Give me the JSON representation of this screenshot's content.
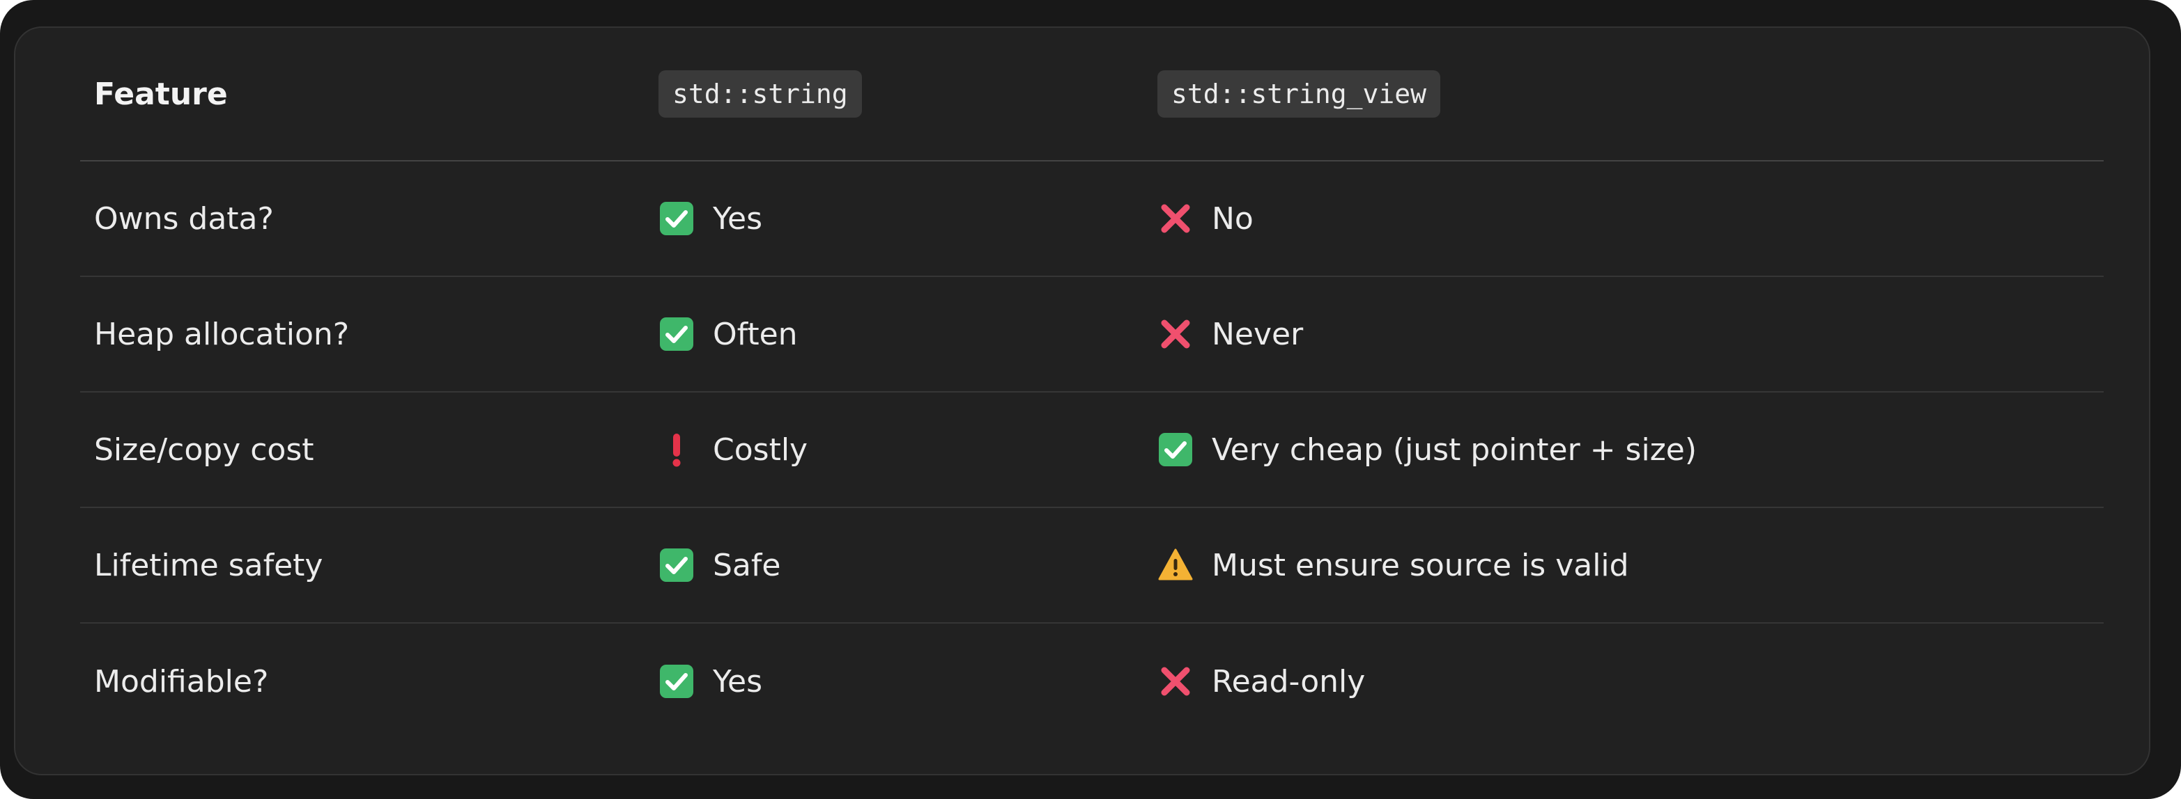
{
  "table": {
    "headers": [
      "Feature",
      "std::string",
      "std::string_view"
    ],
    "rows": [
      {
        "feature": "Owns data?",
        "string": {
          "icon": "check-mark-icon",
          "text": "Yes"
        },
        "view": {
          "icon": "cross-mark-icon",
          "text": "No"
        }
      },
      {
        "feature": "Heap allocation?",
        "string": {
          "icon": "check-mark-icon",
          "text": "Often"
        },
        "view": {
          "icon": "cross-mark-icon",
          "text": "Never"
        }
      },
      {
        "feature": "Size/copy cost",
        "string": {
          "icon": "exclamation-icon",
          "text": "Costly"
        },
        "view": {
          "icon": "check-mark-icon",
          "text": "Very cheap (just pointer + size)"
        }
      },
      {
        "feature": "Lifetime safety",
        "string": {
          "icon": "check-mark-icon",
          "text": "Safe"
        },
        "view": {
          "icon": "warning-icon",
          "text": "Must ensure source is valid"
        }
      },
      {
        "feature": "Modifiable?",
        "string": {
          "icon": "check-mark-icon",
          "text": "Yes"
        },
        "view": {
          "icon": "cross-mark-icon",
          "text": "Read-only"
        }
      }
    ]
  },
  "colors": {
    "check": "#3fb76a",
    "cross": "#f0506e",
    "exclamation": "#e5334a",
    "warning": "#f4b234"
  }
}
